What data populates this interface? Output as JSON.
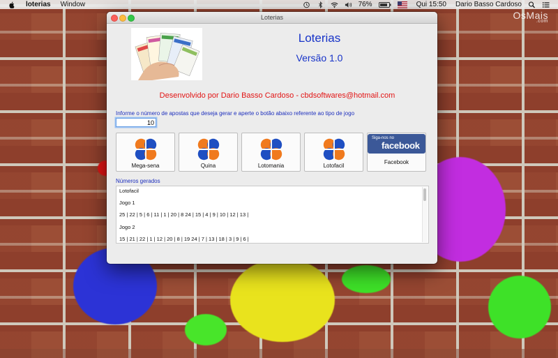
{
  "menubar": {
    "app_name": "loterias",
    "menus": [
      "Window"
    ],
    "battery": "76%",
    "clock": "Qui 15:50",
    "user": "Dario Basso Cardoso"
  },
  "wallpaper": {
    "watermark": "OsMais",
    "watermark_sub": ".com"
  },
  "window": {
    "title": "Loterias",
    "app_title": "Loterias",
    "version": "Versão 1.0",
    "developer": "Desenvolvido por Dario Basso Cardoso - cbdsoftwares@hotmail.com",
    "instruction": "Informe o número de apostas que deseja gerar e aperte o botão abaixo referente ao tipo de jogo",
    "quantity_value": "10",
    "buttons": [
      "Mega-sena",
      "Quina",
      "Lotomania",
      "Lotofacil",
      "Facebook"
    ],
    "facebook_badge_small": "Siga-nos no",
    "facebook_badge_big": "facebook",
    "generated_label": "Números gerados",
    "output_lines": [
      "Lotofacil",
      "Jogo 1",
      "25  | 22  | 5  | 6  | 11  | 1  | 20  | 8 24  | 15  | 4  | 9  | 10  | 12  | 13  |",
      "Jogo 2",
      "15  | 21  | 22  | 1  | 12  | 20  | 8  | 19 24  | 7  | 13  | 18  | 3  | 9  | 6  |"
    ]
  },
  "colors": {
    "accent_blue": "#1733c8",
    "developer_red": "#e21414",
    "facebook_blue": "#3b5898",
    "clover_blue": "#1f4fc2",
    "clover_orange": "#f07a1e"
  }
}
